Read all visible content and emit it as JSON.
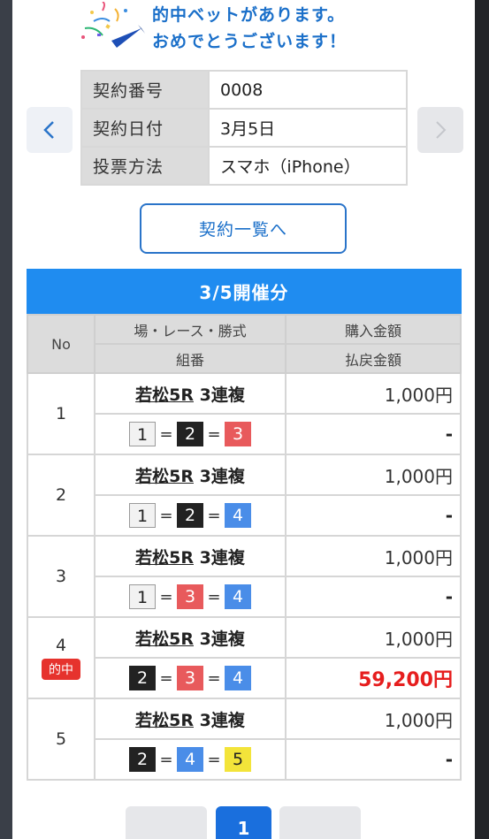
{
  "header": {
    "line1": "的中ベットがあります。",
    "line2": "おめでとうございます！",
    "icon": "party-popper-icon"
  },
  "contract": {
    "rows": [
      {
        "key": "契約番号",
        "value": "0008"
      },
      {
        "key": "契約日付",
        "value": "3月5日"
      },
      {
        "key": "投票方法",
        "value": "スマホ（iPhone）"
      }
    ],
    "list_button": "契約一覧へ"
  },
  "results": {
    "title": "3/5開催分",
    "headers": {
      "no": "No",
      "bet_top": "場・レース・勝式",
      "bet_bottom": "組番",
      "amt_top": "購入金額",
      "amt_bottom": "払戻金額"
    },
    "rows": [
      {
        "no": "1",
        "place": "若松5R",
        "type": "3連複",
        "combo": [
          "1",
          "2",
          "3"
        ],
        "purchase": "1,000円",
        "payout": "-",
        "hit": ""
      },
      {
        "no": "2",
        "place": "若松5R",
        "type": "3連複",
        "combo": [
          "1",
          "2",
          "4"
        ],
        "purchase": "1,000円",
        "payout": "-",
        "hit": ""
      },
      {
        "no": "3",
        "place": "若松5R",
        "type": "3連複",
        "combo": [
          "1",
          "3",
          "4"
        ],
        "purchase": "1,000円",
        "payout": "-",
        "hit": ""
      },
      {
        "no": "4",
        "place": "若松5R",
        "type": "3連複",
        "combo": [
          "2",
          "3",
          "4"
        ],
        "purchase": "1,000円",
        "payout": "59,200円",
        "hit": "的中"
      },
      {
        "no": "5",
        "place": "若松5R",
        "type": "3連複",
        "combo": [
          "2",
          "4",
          "5"
        ],
        "purchase": "1,000円",
        "payout": "-",
        "hit": ""
      }
    ],
    "eq": "="
  },
  "pager": {
    "current": "1"
  },
  "colors": {
    "accent": "#1f8cf0",
    "win": "#e61e1e"
  }
}
